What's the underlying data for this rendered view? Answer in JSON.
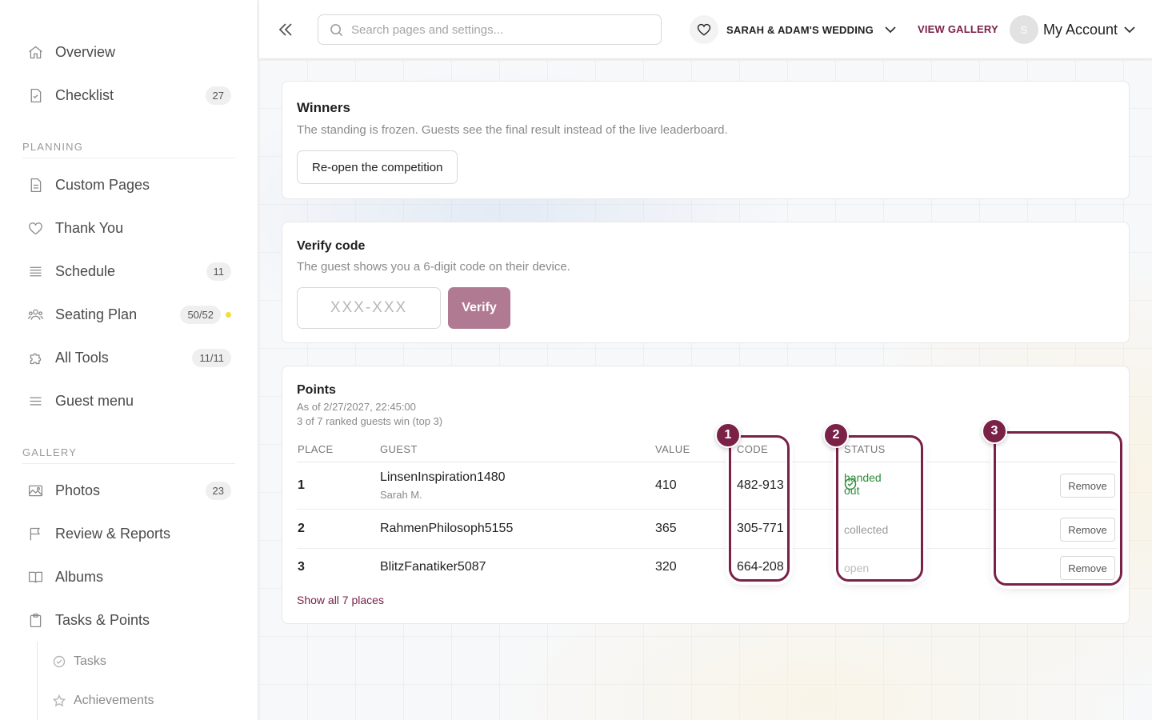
{
  "sidebar": {
    "top_items": [
      {
        "label": "Overview",
        "icon": "home-icon"
      },
      {
        "label": "Checklist",
        "icon": "checklist-icon",
        "badge": "27"
      }
    ],
    "planning_label": "PLANNING",
    "planning_items": [
      {
        "label": "Custom Pages",
        "icon": "document-icon"
      },
      {
        "label": "Thank You",
        "icon": "heart-icon"
      },
      {
        "label": "Schedule",
        "icon": "list-icon",
        "badge": "11"
      },
      {
        "label": "Seating Plan",
        "icon": "users-icon",
        "badge": "50/52"
      },
      {
        "label": "All Tools",
        "icon": "puzzle-icon",
        "badge": "11/11"
      },
      {
        "label": "Guest menu",
        "icon": "menu-icon"
      }
    ],
    "gallery_label": "GALLERY",
    "gallery_items": [
      {
        "label": "Photos",
        "icon": "image-icon",
        "badge": "23"
      },
      {
        "label": "Review & Reports",
        "icon": "flag-icon"
      },
      {
        "label": "Albums",
        "icon": "book-icon"
      },
      {
        "label": "Tasks & Points",
        "icon": "clipboard-icon"
      }
    ],
    "sub_items": [
      {
        "label": "Tasks",
        "icon": "check-circle-icon"
      },
      {
        "label": "Achievements",
        "icon": "star-icon"
      }
    ],
    "seating_dot_color": "#f2dd3b"
  },
  "topbar": {
    "search_placeholder": "Search pages and settings...",
    "event_name": "SARAH & ADAM'S WEDDING",
    "view_gallery": "VIEW GALLERY",
    "avatar_initial": "S",
    "account_label": "My Account"
  },
  "winners": {
    "title": "Winners",
    "description": "The standing is frozen. Guests see the final result instead of the live leaderboard.",
    "reopen_label": "Re-open the competition"
  },
  "verify": {
    "title": "Verify code",
    "description": "The guest shows you a 6-digit code on their device.",
    "input_placeholder": "XXX-XXX",
    "button_label": "Verify"
  },
  "points": {
    "title": "Points",
    "as_of": "As of 2/27/2027, 22:45:00",
    "summary": "3 of 7 ranked guests win (top 3)",
    "columns": {
      "place": "PLACE",
      "guest": "GUEST",
      "value": "VALUE",
      "code": "CODE",
      "status": "STATUS"
    },
    "rows": [
      {
        "place": "1",
        "guest": "LinsenInspiration1480",
        "guest_sub": "Sarah M.",
        "value": "410",
        "code": "482-913",
        "status": "handed out",
        "action": "Remove"
      },
      {
        "place": "2",
        "guest": "RahmenPhilosoph5155",
        "guest_sub": "",
        "value": "365",
        "code": "305-771",
        "status": "collected",
        "action": "Remove"
      },
      {
        "place": "3",
        "guest": "BlitzFanatiker5087",
        "guest_sub": "",
        "value": "320",
        "code": "664-208",
        "status": "open",
        "action": "Remove"
      }
    ],
    "show_all": "Show all 7 places"
  },
  "annotations": [
    "1",
    "2",
    "3"
  ],
  "colors": {
    "accent": "#7a2148",
    "verify_button": "#b07a93",
    "success": "#2e8b3a"
  }
}
